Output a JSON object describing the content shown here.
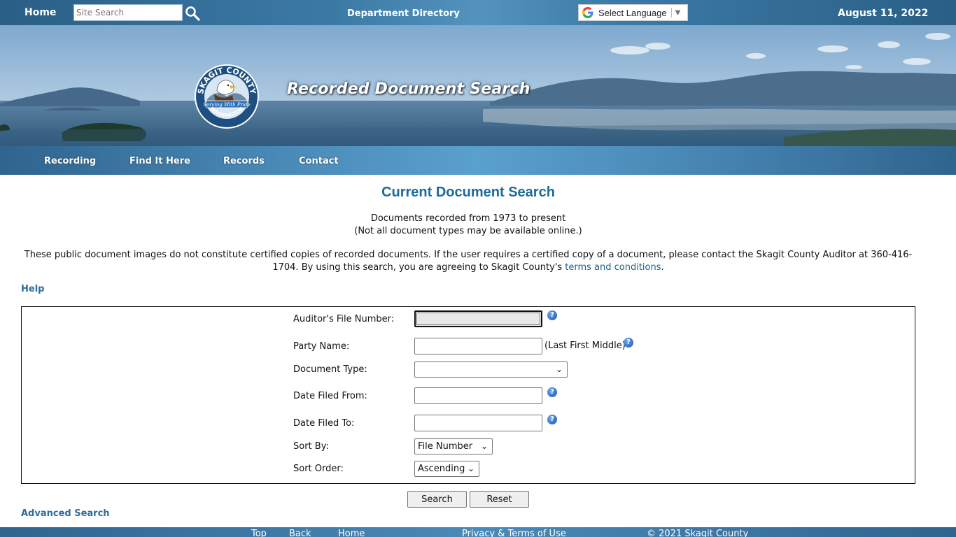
{
  "topbar": {
    "home_label": "Home",
    "search_placeholder": "Site Search",
    "department_directory": "Department Directory",
    "language_label": "Select Language",
    "date": "August 11, 2022"
  },
  "banner": {
    "seal_text_top": "SKAGIT COUNTY",
    "seal_text_motto": "Serving With Pride",
    "seal_text_bottom": "WASHINGTON",
    "title": "Recorded Document Search"
  },
  "nav": {
    "items": [
      {
        "label": "Recording"
      },
      {
        "label": "Find It Here"
      },
      {
        "label": "Records"
      },
      {
        "label": "Contact"
      }
    ]
  },
  "main": {
    "title": "Current Document Search",
    "subtitle_1": "Documents recorded from 1973 to present",
    "subtitle_2": "(Not all document types may be available online.)",
    "disclaimer": "These public document images do not constitute certified copies of recorded documents. If the user requires a certified copy of a document, please contact the Skagit County Auditor at 360-416-1704. By using this search, you are agreeing to Skagit County's ",
    "disclaimer_link": "terms and conditions",
    "disclaimer_end": ".",
    "help_label": "Help",
    "advanced_search_label": "Advanced Search"
  },
  "form": {
    "auditor_file_number_label": "Auditor's File Number:",
    "auditor_file_number_value": "",
    "party_name_label": "Party Name:",
    "party_name_value": "",
    "party_name_hint": "(Last First Middle)",
    "document_type_label": "Document Type:",
    "document_type_value": "",
    "date_from_label": "Date Filed From:",
    "date_from_value": "",
    "date_to_label": "Date Filed To:",
    "date_to_value": "",
    "sort_by_label": "Sort By:",
    "sort_by_value": "File Number",
    "sort_order_label": "Sort Order:",
    "sort_order_value": "Ascending",
    "help_icon_glyph": "?",
    "search_button": "Search",
    "reset_button": "Reset"
  },
  "footer": {
    "top": "Top",
    "back": "Back",
    "home": "Home",
    "privacy": "Privacy & Terms of Use",
    "copyright": "© 2021 Skagit County"
  },
  "colors": {
    "accent_blue": "#1b6b99",
    "link_blue": "#2f6d9a",
    "bar_blue": "#3c7aa6"
  }
}
